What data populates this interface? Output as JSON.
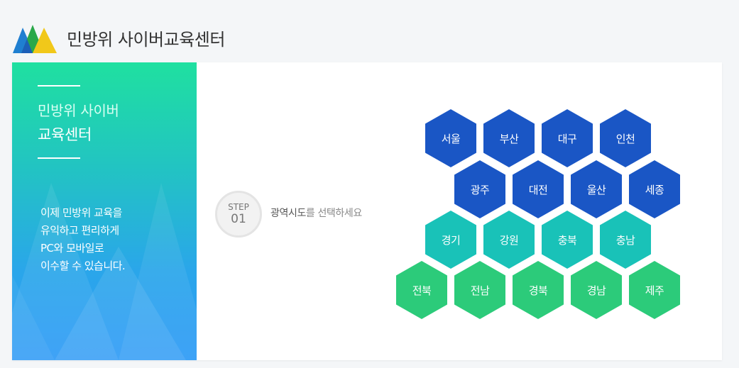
{
  "header": {
    "title": "민방위 사이버교육센터"
  },
  "sidebar": {
    "title_line1": "민방위 사이버",
    "title_line2": "교육센터",
    "description": [
      "이제 민방위 교육을",
      "유익하고 편리하게",
      "PC와 모바일로",
      "이수할 수 있습니다."
    ]
  },
  "step": {
    "label": "STEP",
    "number": "01"
  },
  "instruction": {
    "highlight": "광역시도",
    "rest": "를 선택하세요"
  },
  "regions": {
    "row1": [
      "서울",
      "부산",
      "대구",
      "인천"
    ],
    "row2": [
      "광주",
      "대전",
      "울산",
      "세종"
    ],
    "row3": [
      "경기",
      "강원",
      "충북",
      "충남"
    ],
    "row4": [
      "전북",
      "전남",
      "경북",
      "경남",
      "제주"
    ]
  },
  "colors": {
    "metro": "#1a56c5",
    "central": "#19c2b8",
    "south": "#2ccb7a"
  }
}
